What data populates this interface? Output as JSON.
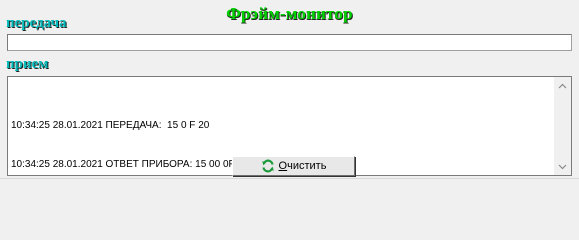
{
  "window": {
    "title": "Фрэйм-монитор"
  },
  "send": {
    "label": "передача",
    "value": ""
  },
  "receive": {
    "label": "прием",
    "lines": [
      "10:34:25 28.01.2021 ПЕРЕДАЧА:  15 0 F 20",
      "10:34:25 28.01.2021 ОТВЕТ ПРИБОРА: 15 00 0F 20"
    ]
  },
  "buttons": {
    "clear_accel": "О",
    "clear_rest": "чистить"
  },
  "icons": {
    "clear": "refresh-icon",
    "scroll_up": "chevron-up-icon",
    "scroll_down": "chevron-down-icon"
  },
  "colors": {
    "title": "#00d400",
    "label": "#00b8b8"
  }
}
